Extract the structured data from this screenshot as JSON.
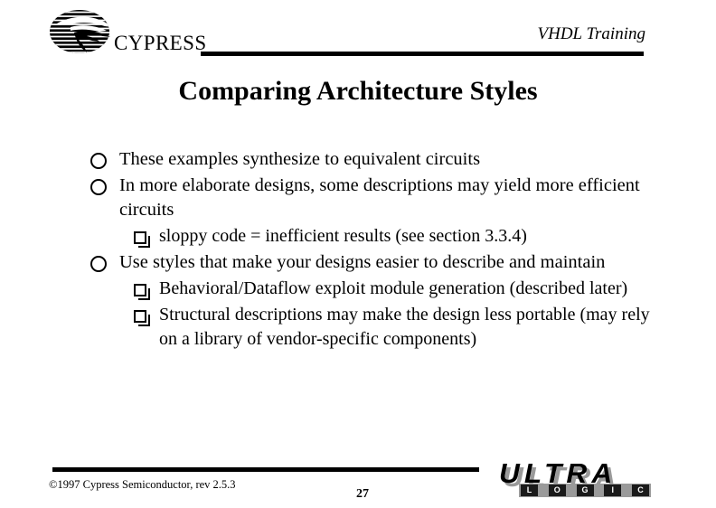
{
  "header": {
    "brand": "CYPRESS",
    "subject": "VHDL Training"
  },
  "title": "Comparing Architecture Styles",
  "body": {
    "bullets": [
      {
        "level": 1,
        "marker": "circle-bullet",
        "text": "These examples synthesize to equivalent circuits"
      },
      {
        "level": 1,
        "marker": "circle-bullet",
        "text": "In more elaborate designs, some descriptions may yield more efficient circuits"
      },
      {
        "level": 2,
        "marker": "square-bullet",
        "text": "sloppy code = inefficient results (see section 3.3.4)"
      },
      {
        "level": 1,
        "marker": "circle-bullet",
        "text": "Use styles that make your designs easier to describe and maintain"
      },
      {
        "level": 2,
        "marker": "square-bullet",
        "text": "Behavioral/Dataflow exploit module generation (described later)"
      },
      {
        "level": 2,
        "marker": "square-bullet",
        "text": "Structural descriptions may make the design less portable (may rely on a library of vendor-specific components)"
      }
    ]
  },
  "footer": {
    "copyright": "©1997 Cypress Semiconductor, rev 2.5.3",
    "page_number": "27",
    "logo": {
      "wordmark": "ULTRA",
      "sub_letters": [
        "L",
        "O",
        "G",
        "I",
        "C"
      ]
    }
  },
  "colors": {
    "ink": "#000000",
    "background": "#ffffff",
    "logo_shadow": "#9a9a9a",
    "logic_cell": "#1a1a1a"
  }
}
